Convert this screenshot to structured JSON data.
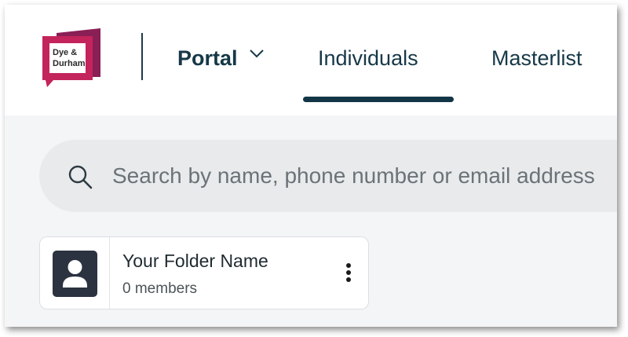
{
  "brand": {
    "logo_line1": "Dye &",
    "logo_line2": "Durham",
    "accent": "#c3245c"
  },
  "nav": {
    "portal_label": "Portal",
    "tabs": [
      {
        "label": "Individuals",
        "active": true
      },
      {
        "label": "Masterlist",
        "active": false
      }
    ]
  },
  "search": {
    "placeholder": "Search by name, phone number or email address"
  },
  "folders": [
    {
      "name": "Your Folder Name",
      "members": "0 members"
    }
  ]
}
